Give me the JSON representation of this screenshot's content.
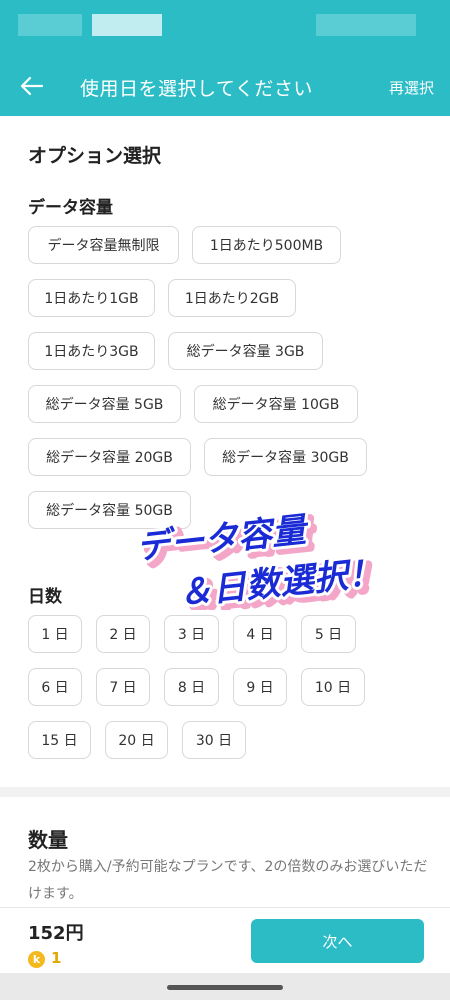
{
  "colors": {
    "accent": "#2bbcc6",
    "overlay_text": "#1a2bd6",
    "overlay_shadow": "#f4a6c8",
    "coin": "#f3b91d"
  },
  "appbar": {
    "title": "使用日を選択してください",
    "reselect": "再選択",
    "back_icon": "arrow-left-icon"
  },
  "options": {
    "heading": "オプション選択",
    "data_heading": "データ容量",
    "data_chips": [
      "データ容量無制限",
      "1日あたり500MB",
      "1日あたり1GB",
      "1日あたり2GB",
      "1日あたり3GB",
      "総データ容量 3GB",
      "総データ容量 5GB",
      "総データ容量 10GB",
      "総データ容量 20GB",
      "総データ容量 30GB",
      "総データ容量 50GB"
    ],
    "days_heading": "日数",
    "day_chips": [
      "1 日",
      "2 日",
      "3 日",
      "4 日",
      "5 日",
      "6 日",
      "7 日",
      "8 日",
      "9 日",
      "10 日",
      "15 日",
      "20 日",
      "30 日"
    ]
  },
  "overlay": {
    "line1": "データ容量",
    "line2": "＆日数選択！"
  },
  "quantity": {
    "heading": "数量",
    "description": "2枚から購入/予約可能なプランです、2の倍数のみお選びいただけます。"
  },
  "footer": {
    "price": "152円",
    "coin_symbol": "k",
    "coin_count": "1",
    "next_label": "次へ"
  }
}
